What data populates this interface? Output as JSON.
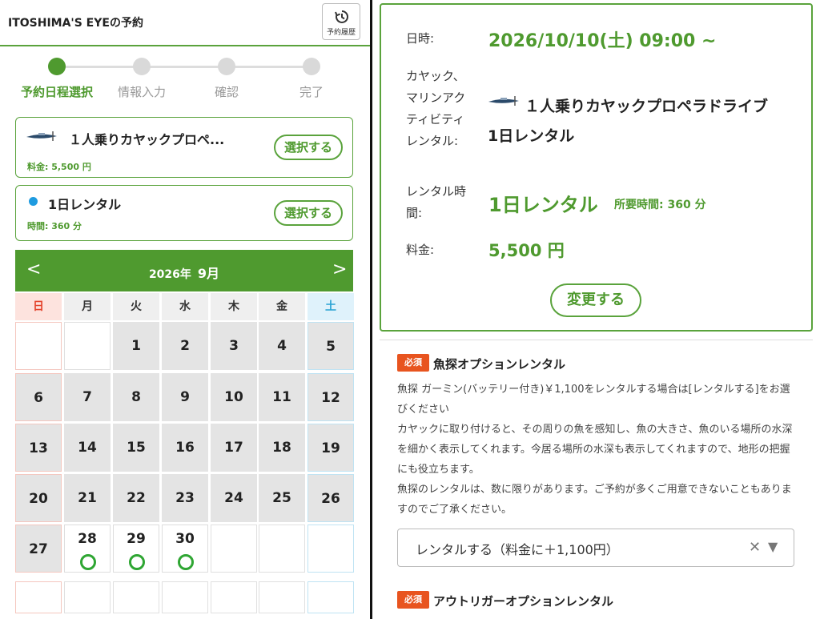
{
  "header": {
    "title": "ITOSHIMA'S EYEの予約",
    "history_label": "予約履歴"
  },
  "steps": [
    {
      "label": "予約日程選択",
      "active": true
    },
    {
      "label": "情報入力",
      "active": false
    },
    {
      "label": "確認",
      "active": false
    },
    {
      "label": "完了",
      "active": false
    }
  ],
  "plan_card": {
    "title": "１人乗りカヤックプロペ...",
    "price": "料金: 5,500 円",
    "button": "選択する"
  },
  "rental_card": {
    "title": "1日レンタル",
    "duration": "時間: 360 分",
    "button": "選択する"
  },
  "calendar": {
    "year": "2026年",
    "month": "9月",
    "prev": "<",
    "next": ">",
    "weekdays": [
      "日",
      "月",
      "火",
      "水",
      "木",
      "金",
      "土"
    ],
    "days": [
      "",
      "",
      "1",
      "2",
      "3",
      "4",
      "5",
      "6",
      "7",
      "8",
      "9",
      "10",
      "11",
      "12",
      "13",
      "14",
      "15",
      "16",
      "17",
      "18",
      "19",
      "20",
      "21",
      "22",
      "23",
      "24",
      "25",
      "26",
      "27",
      "28",
      "29",
      "30",
      "",
      "",
      "",
      "",
      "",
      "",
      "",
      "",
      "",
      ""
    ],
    "available": [
      "28",
      "29",
      "30"
    ]
  },
  "summary": {
    "datetime_label": "日時:",
    "datetime_value": "2026/10/10(土) 09:00 ~",
    "plan_label": "カヤック、マリンアクティビティレンタル:",
    "plan_value": "１人乗りカヤックプロペラドライブ　1日レンタル",
    "rental_label": "レンタル時間:",
    "rental_value": "1日レンタル",
    "rental_duration": "所要時間: 360 分",
    "price_label": "料金:",
    "price_value": "5,500 円",
    "change_button": "変更する"
  },
  "options": [
    {
      "badge": "必須",
      "title": "魚探オプションレンタル",
      "description": "魚探 ガーミン(バッテリー付き)￥1,100をレンタルする場合は[レンタルする]をお選びください\nカヤックに取り付けると、その周りの魚を感知し、魚の大きさ、魚のいる場所の水深を細かく表示してくれます。今居る場所の水深も表示してくれますので、地形の把握にも役立ちます。\n魚探のレンタルは、数に限りがあります。ご予約が多くご用意できないこともありますのでご了承ください。",
      "selected": "レンタルする（料金に＋1,100円）"
    },
    {
      "badge": "必須",
      "title": "アウトリガーオプションレンタル"
    }
  ],
  "colors": {
    "accent": "#4f9a2f",
    "badge": "#e8541f",
    "available": "#2fa633"
  }
}
